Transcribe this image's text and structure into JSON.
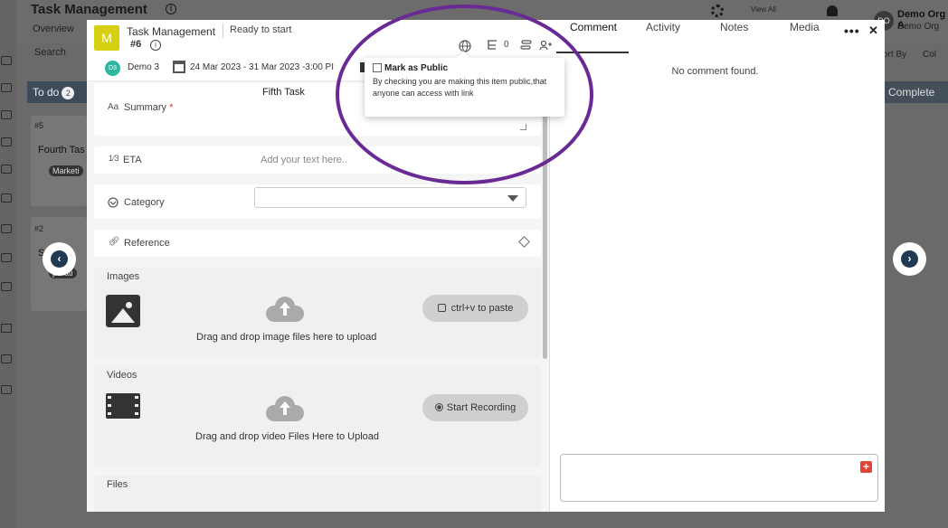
{
  "background_app": {
    "title": "Task Management",
    "info": "i",
    "overview": "Overview",
    "search": "Search",
    "view_all": "View All",
    "org_initials": "DO",
    "org_name": "Demo Org A",
    "org_sub": "Demo Org",
    "todo_label": "To do",
    "todo_count": "2",
    "completed_label": "Complete",
    "sort_by": "ort By",
    "col": "Col",
    "card1": {
      "id": "#5",
      "title": "Fourth Tas",
      "tag": "Marketi"
    },
    "card2": {
      "id": "#2",
      "title": "S",
      "tag": "perati"
    }
  },
  "modal": {
    "badge": "M",
    "title": "Task Management",
    "status": "Ready to start",
    "id": "#6",
    "subtask_count": "0",
    "more": "•••",
    "close": "✕",
    "tabs": [
      "Comment",
      "Activity",
      "Notes",
      "Media"
    ]
  },
  "meta": {
    "assignee_initials": "D3",
    "assignee": "Demo 3",
    "date_range": "24 Mar 2023 - 31 Mar 2023 -3:00 PI"
  },
  "form": {
    "summary_label": "Summary",
    "summary_required": "*",
    "summary_value": "Fifth Task",
    "eta_label": "ETA",
    "eta_placeholder": "Add your text here..",
    "category_label": "Category",
    "category_value": "",
    "reference_label": "Reference",
    "images_title": "Images",
    "images_drop": "Drag and drop image files here to upload",
    "paste_label": "ctrl+v to paste",
    "videos_title": "Videos",
    "videos_drop": "Drag and drop video Files Here to Upload",
    "record_label": "Start Recording",
    "files_title": "Files"
  },
  "comments": {
    "empty": "No comment found.",
    "add": "+"
  },
  "popover": {
    "title": "Mark as Public",
    "text": "By checking you are making this item public,that anyone can access with link"
  },
  "nav": {
    "prev": "‹",
    "next": "›"
  },
  "colors": {
    "badge": "#d6cf12",
    "highlight": "#6a2a96",
    "assignee": "#2db79e",
    "add_button": "#e0453a"
  }
}
